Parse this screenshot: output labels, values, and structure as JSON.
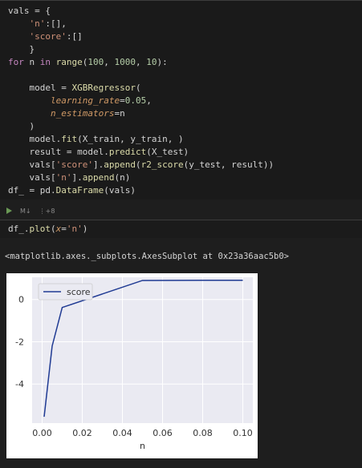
{
  "cell1": {
    "lines": [
      [
        [
          "var",
          "vals"
        ],
        [
          "op",
          " = {"
        ]
      ],
      [
        [
          "op",
          "    "
        ],
        [
          "str",
          "'n'"
        ],
        [
          "op",
          ":[],"
        ]
      ],
      [
        [
          "op",
          "    "
        ],
        [
          "str",
          "'score'"
        ],
        [
          "op",
          ":[]"
        ]
      ],
      [
        [
          "op",
          "    }"
        ]
      ],
      [
        [
          "kw",
          "for"
        ],
        [
          "op",
          " n "
        ],
        [
          "kw",
          "in"
        ],
        [
          "op",
          " "
        ],
        [
          "fn",
          "range"
        ],
        [
          "op",
          "("
        ],
        [
          "num",
          "100"
        ],
        [
          "op",
          ", "
        ],
        [
          "num",
          "1000"
        ],
        [
          "op",
          ", "
        ],
        [
          "num",
          "10"
        ],
        [
          "op",
          "):"
        ]
      ],
      [
        [
          "op",
          ""
        ]
      ],
      [
        [
          "op",
          "    model = "
        ],
        [
          "fn",
          "XGBRegressor"
        ],
        [
          "op",
          "("
        ]
      ],
      [
        [
          "op",
          "        "
        ],
        [
          "param",
          "learning_rate"
        ],
        [
          "op",
          "="
        ],
        [
          "num",
          "0.05"
        ],
        [
          "op",
          ","
        ]
      ],
      [
        [
          "op",
          "        "
        ],
        [
          "param",
          "n_estimators"
        ],
        [
          "op",
          "=n"
        ]
      ],
      [
        [
          "op",
          "    )"
        ]
      ],
      [
        [
          "op",
          "    model."
        ],
        [
          "fn",
          "fit"
        ],
        [
          "op",
          "(X_train, y_train, )"
        ]
      ],
      [
        [
          "op",
          "    result = model."
        ],
        [
          "fn",
          "predict"
        ],
        [
          "op",
          "(X_test)"
        ]
      ],
      [
        [
          "op",
          "    vals["
        ],
        [
          "str",
          "'score'"
        ],
        [
          "op",
          "]."
        ],
        [
          "fn",
          "append"
        ],
        [
          "op",
          "("
        ],
        [
          "fn",
          "r2_score"
        ],
        [
          "op",
          "(y_test, result))"
        ]
      ],
      [
        [
          "op",
          "    vals["
        ],
        [
          "str",
          "'n'"
        ],
        [
          "op",
          "]."
        ],
        [
          "fn",
          "append"
        ],
        [
          "op",
          "(n)"
        ]
      ],
      [
        [
          "var",
          "df_"
        ],
        [
          "op",
          " = pd."
        ],
        [
          "fn",
          "DataFrame"
        ],
        [
          "op",
          "(vals)"
        ]
      ]
    ]
  },
  "toolbar": {
    "md_label": "M↓",
    "split_label": "⋮+8"
  },
  "cell2": {
    "lines": [
      [
        [
          "op",
          "df_."
        ],
        [
          "fn",
          "plot"
        ],
        [
          "op",
          "("
        ],
        [
          "param",
          "x"
        ],
        [
          "op",
          "="
        ],
        [
          "str",
          "'n'"
        ],
        [
          "op",
          ")"
        ]
      ]
    ]
  },
  "output": {
    "repr": "<matplotlib.axes._subplots.AxesSubplot at 0x23a36aac5b0>"
  },
  "chart_data": {
    "type": "line",
    "xlabel": "n",
    "ylabel": "",
    "title": "",
    "xlim": [
      -0.005,
      0.105
    ],
    "ylim": [
      -5.85,
      1.05
    ],
    "xticks": [
      "0.00",
      "0.02",
      "0.04",
      "0.06",
      "0.08",
      "0.10"
    ],
    "xtick_values": [
      0.0,
      0.02,
      0.04,
      0.06,
      0.08,
      0.1
    ],
    "yticks": [
      "0",
      "-2",
      "-4"
    ],
    "ytick_values": [
      0,
      -2,
      -4
    ],
    "grid": true,
    "legend": "top-left",
    "series": [
      {
        "name": "score",
        "color": "#1f3a93",
        "x": [
          0.001,
          0.005,
          0.01,
          0.05,
          0.1
        ],
        "y": [
          -5.55,
          -2.2,
          -0.38,
          0.9,
          0.91
        ]
      }
    ],
    "background": "#eaeaf2"
  }
}
